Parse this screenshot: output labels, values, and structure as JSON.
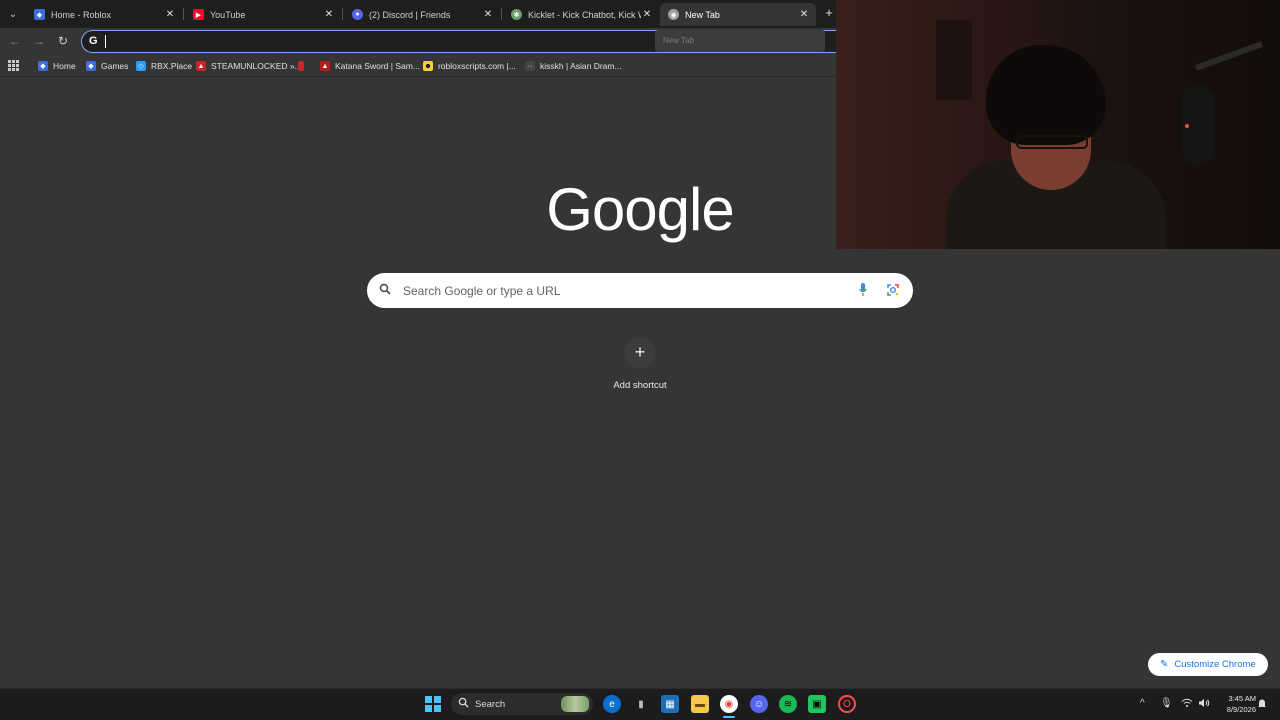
{
  "tabs": [
    {
      "title": "Home - Roblox",
      "favicon_color": "#3b6fe0",
      "close": "✕"
    },
    {
      "title": "YouTube",
      "favicon_color": "#ff0033",
      "close": "✕"
    },
    {
      "title": "(2) Discord | Friends",
      "favicon_color": "#5865f2",
      "close": "✕"
    },
    {
      "title": "Kicklet - Kick Chatbot, Kick Wid",
      "favicon_color": "#6fa06b",
      "close": "✕"
    },
    {
      "title": "New Tab",
      "favicon_color": "#9aa0a6",
      "close": "✕"
    }
  ],
  "new_tab_button": "+",
  "tooltip_text": "New Tab",
  "toolbar": {
    "back": "←",
    "forward": "→",
    "reload": "↻",
    "omnibox_icon": "G",
    "omnibox_value": ""
  },
  "bookmarks": [
    {
      "label": "Home",
      "color": "#3b6fe0"
    },
    {
      "label": "Games",
      "color": "#3b6fe0"
    },
    {
      "label": "RBX.Place",
      "color": "#2a9df4"
    },
    {
      "label": "STEAMUNLOCKED »...",
      "color": "#c62828"
    },
    {
      "label": "",
      "color": "#c62828"
    },
    {
      "label": "Katana Sword | Sam...",
      "color": "#b71c1c"
    },
    {
      "label": "robloxscripts.com |...",
      "color": "#f4d03f"
    },
    {
      "label": "kisskh | Asian Dram...",
      "color": "#444444"
    }
  ],
  "ntp": {
    "logo": "Google",
    "search_placeholder": "Search Google or type a URL",
    "add_shortcut_icon": "+",
    "add_shortcut_label": "Add shortcut",
    "customize_label": "Customize Chrome"
  },
  "taskbar": {
    "search_label": "Search",
    "clock_time": "3:45 AM",
    "clock_date": "8/9/2026",
    "tray_up": "^"
  },
  "colors": {
    "accent": "#7cacf8",
    "background": "#353535",
    "tabstrip": "#1e1e1e",
    "taskbar": "#1c1c1c"
  }
}
